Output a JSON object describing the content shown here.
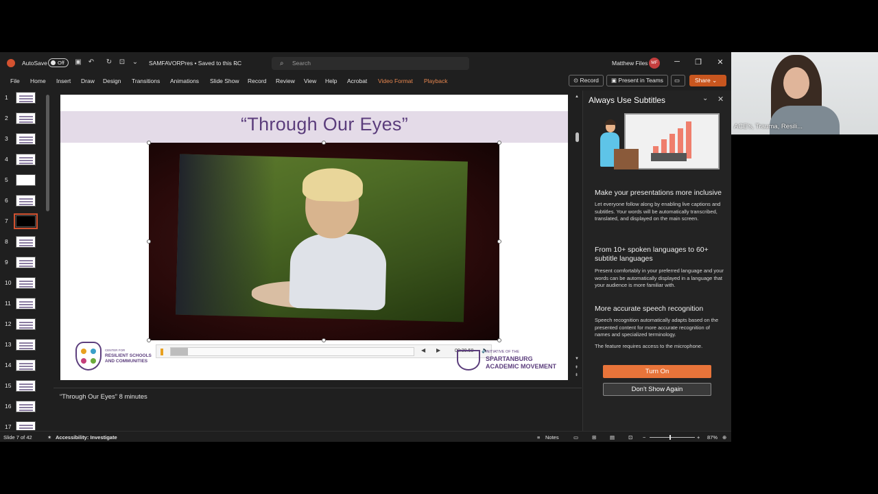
{
  "window": {
    "autosave_label": "AutoSave",
    "autosave_state": "Off",
    "file_title": "SAMFAVORPres • Saved to this PC",
    "search_placeholder": "Search",
    "user_name": "Matthew Files",
    "user_initials": "MF"
  },
  "ribbon": {
    "tabs": [
      "File",
      "Home",
      "Insert",
      "Draw",
      "Design",
      "Transitions",
      "Animations",
      "Slide Show",
      "Record",
      "Review",
      "View",
      "Help",
      "Acrobat",
      "Video Format",
      "Playback"
    ],
    "record_label": "Record",
    "present_teams_label": "Present in Teams",
    "share_label": "Share"
  },
  "thumbnails": {
    "numbers": [
      "1",
      "2",
      "3",
      "4",
      "5",
      "6",
      "7",
      "8",
      "9",
      "10",
      "11",
      "12",
      "13",
      "14",
      "15",
      "16",
      "17"
    ],
    "active_index": 7
  },
  "slide": {
    "title": "“Through Our Eyes”",
    "video_time": "00:30.58",
    "video_progress": 0.07,
    "logo_left_small": "CENTER FOR",
    "logo_left_line1": "RESILIENT SCHOOLS",
    "logo_left_line2": "AND COMMUNITIES",
    "logo_right_small": "INITIATIVE OF THE",
    "logo_right_line1": "SPARTANBURG",
    "logo_right_line2": "ACADEMIC MOVEMENT"
  },
  "notes": {
    "text": "“Through Our Eyes”  8 minutes"
  },
  "pane": {
    "title": "Always Use Subtitles",
    "sections": [
      {
        "heading": "Make your presentations more inclusive",
        "body": "Let everyone follow along by enabling live captions and subtitles. Your words will be automatically transcribed, translated, and displayed on the main screen."
      },
      {
        "heading": "From 10+ spoken languages to 60+ subtitle languages",
        "body": "Present comfortably in your preferred language and your words can be automatically displayed in a language that your audience is more familiar with."
      },
      {
        "heading": "More accurate speech recognition",
        "body": "Speech recognition automatically adapts based on the presented content for more accurate recognition of names and specialized terminology."
      }
    ],
    "note": "The feature requires access to the microphone.",
    "turn_on_label": "Turn On",
    "dont_show_label": "Don't Show Again"
  },
  "statusbar": {
    "slide_counter": "Slide 7 of 42",
    "accessibility": "Accessibility: Investigate",
    "notes_label": "Notes",
    "zoom": "87%"
  },
  "webcam": {
    "name": "ACE's, Trauma, Resili..."
  },
  "colors": {
    "accent": "#d35230",
    "share": "#c8561f",
    "turn_on": "#e8743a",
    "slide_purple": "#5b3d7c",
    "ribbon_contextual": "#e8874f"
  }
}
